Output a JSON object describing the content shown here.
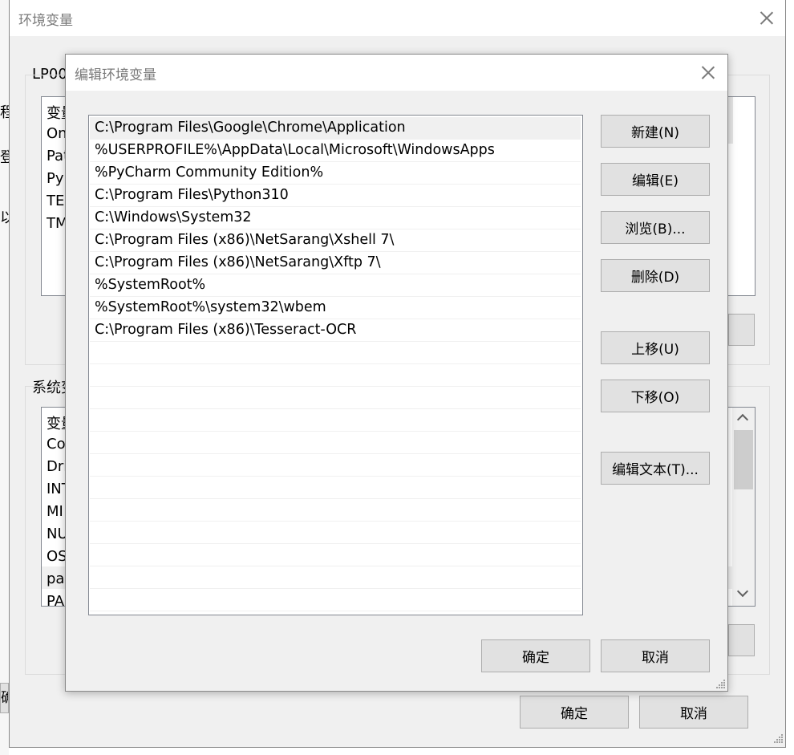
{
  "background_window": {
    "title": "环境变量",
    "user_section_label": "LP00",
    "user_vars_header": "变量",
    "user_vars": [
      "On",
      "Pat",
      "Py",
      "TEI",
      "TM"
    ],
    "system_section_label": "系统变",
    "system_vars_header": "变量",
    "system_vars": [
      "Co",
      "Dri",
      "INT",
      "MI",
      "NU",
      "OS",
      "pat",
      "PA"
    ],
    "ok_label": "确定",
    "cancel_label": "取消"
  },
  "left_edge_fragments": [
    "程",
    "登",
    "以",
    "确"
  ],
  "dialog": {
    "title": "编辑环境变量",
    "paths": [
      "C:\\Program Files\\Google\\Chrome\\Application",
      "%USERPROFILE%\\AppData\\Local\\Microsoft\\WindowsApps",
      "%PyCharm Community Edition%",
      "C:\\Program Files\\Python310",
      "C:\\Windows\\System32",
      "C:\\Program Files (x86)\\NetSarang\\Xshell 7\\",
      "C:\\Program Files (x86)\\NetSarang\\Xftp 7\\",
      "%SystemRoot%",
      "%SystemRoot%\\system32\\wbem",
      "C:\\Program Files (x86)\\Tesseract-OCR"
    ],
    "selected_index": 0,
    "buttons": {
      "new": "新建(N)",
      "edit": "编辑(E)",
      "browse": "浏览(B)...",
      "delete": "删除(D)",
      "move_up": "上移(U)",
      "move_down": "下移(O)",
      "edit_text": "编辑文本(T)..."
    },
    "ok_label": "确定",
    "cancel_label": "取消"
  },
  "colors": {
    "window_bg": "#f0f0f0",
    "button_bg": "#e1e1e1",
    "button_border": "#adadad",
    "title_text": "#7a7a7a",
    "list_border": "#828790",
    "selected_row": "#f0f0f0"
  }
}
